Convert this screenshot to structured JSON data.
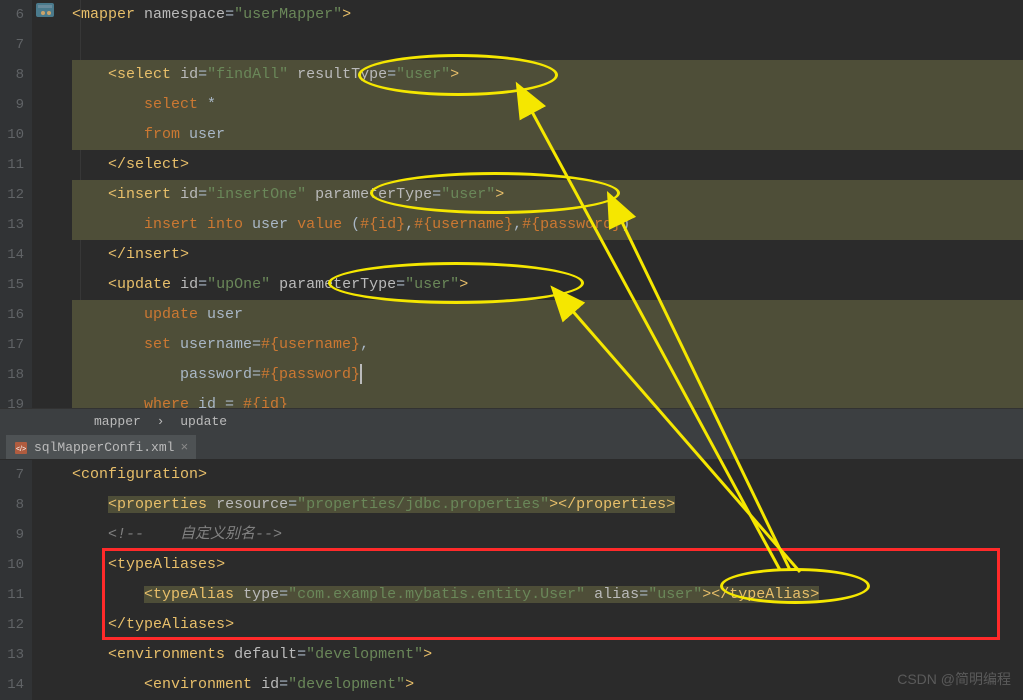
{
  "top_editor": {
    "file_icon": "xml-file-icon",
    "lines_start": 6,
    "breadcrumb": [
      "mapper",
      "update"
    ],
    "tokens": {
      "l6": {
        "tag": "mapper",
        "attr": "namespace",
        "val": "\"userMapper\""
      },
      "l8": {
        "tag": "select",
        "a1": "id",
        "v1": "\"findAll\"",
        "a2": "resultType",
        "v2": "\"user\""
      },
      "l9a": "select",
      "l9b": " *",
      "l10a": "from",
      "l10b": " user",
      "l11": "select",
      "l12": {
        "tag": "insert",
        "a1": "id",
        "v1": "\"insertOne\"",
        "a2": "parameterType",
        "v2": "\"user\""
      },
      "l13a": "insert into",
      "l13b": " user ",
      "l13c": "value",
      "l13d": " (",
      "l13e": "#{id}",
      "l13f": ",",
      "l13g": "#{username}",
      "l13h": ",",
      "l13i": "#{password}",
      "l13j": ")",
      "l14": "insert",
      "l15": {
        "tag": "update",
        "a1": "id",
        "v1": "\"upOne\"",
        "a2": "parameterType",
        "v2": "\"user\""
      },
      "l16a": "update",
      "l16b": " user",
      "l17a": "set",
      "l17b": " username=",
      "l17c": "#{username}",
      "l17d": ",",
      "l18a": "password=",
      "l18b": "#{password}",
      "l19a": "where",
      "l19b": " id = ",
      "l19c": "#{id}"
    }
  },
  "bottom_editor": {
    "tab": {
      "label": "sqlMapperConfi.xml"
    },
    "lines_start": 7,
    "tokens": {
      "l7": "configuration",
      "l8": {
        "tag": "properties",
        "a": "resource",
        "v": "\"properties/jdbc.properties\"",
        "close": "properties"
      },
      "l9a": "<!--",
      "l9b": "    自定义别名",
      "l9c": "-->",
      "l10": "typeAliases",
      "l11": {
        "tag": "typeAlias",
        "a1": "type",
        "v1": "\"com.example.mybatis.entity.User\"",
        "a2": "alias",
        "v2": "\"user\"",
        "close": "typeAlias"
      },
      "l12": "typeAliases",
      "l13": {
        "tag": "environments",
        "a": "default",
        "v": "\"development\""
      },
      "l14": {
        "tag": "environment",
        "a": "id",
        "v": "\"development\""
      }
    }
  },
  "watermark": "CSDN @简明编程"
}
